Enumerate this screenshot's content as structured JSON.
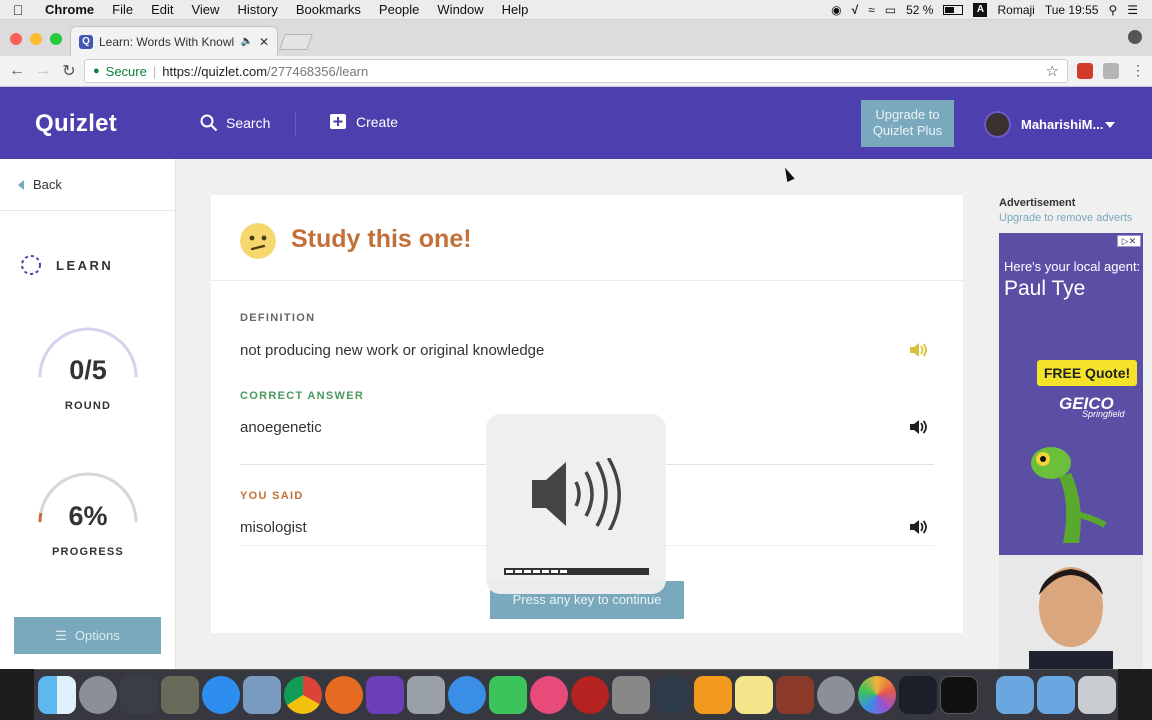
{
  "menubar": {
    "app": "Chrome",
    "items": [
      "File",
      "Edit",
      "View",
      "History",
      "Bookmarks",
      "People",
      "Window",
      "Help"
    ],
    "battery": "52 %",
    "input_source": "Romaji",
    "clock": "Tue 19:55"
  },
  "browser": {
    "tab_title": "Learn: Words With Knowled",
    "secure_label": "Secure",
    "url_host": "https://quizlet.com",
    "url_path": "/277468356/learn"
  },
  "header": {
    "logo": "Quizlet",
    "search_label": "Search",
    "create_label": "Create",
    "upgrade_line1": "Upgrade to",
    "upgrade_line2": "Quizlet Plus",
    "username": "MaharishiM..."
  },
  "sidebar": {
    "back_label": "Back",
    "mode_label": "LEARN",
    "round_value": "0/5",
    "round_label": "ROUND",
    "round_fraction": 0,
    "progress_value": "6%",
    "progress_label": "PROGRESS",
    "progress_fraction": 0.06,
    "options_label": "Options"
  },
  "card": {
    "heading": "Study this one!",
    "definition_label": "DEFINITION",
    "definition_text": "not producing new work or original knowledge",
    "correct_label": "CORRECT ANSWER",
    "correct_text": "anoegenetic",
    "you_said_label": "YOU SAID",
    "you_said_text": "misologist",
    "continue_label": "Press any key to continue"
  },
  "volume_overlay": {
    "level_segments": 7,
    "total_segments": 16
  },
  "ad": {
    "label": "Advertisement",
    "upgrade_link": "Upgrade to remove adverts",
    "line1": "Here's your local agent:",
    "line2": "Paul Tye",
    "quote_button": "FREE Quote!",
    "brand": "GEICO",
    "brand_sub": "Springfield"
  },
  "colors": {
    "quizlet_purple": "#4e3fae",
    "accent_teal": "#7aa8bc",
    "heading_orange": "#c36f3a",
    "correct_green": "#4a9a5c",
    "wrong_orange": "#c36f3a"
  }
}
